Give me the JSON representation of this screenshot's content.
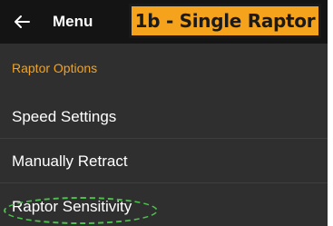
{
  "header": {
    "back_icon": "arrow-left-icon",
    "title": "Menu",
    "badge": "1b - Single Raptor",
    "badge_color": "#f5a31c"
  },
  "section": {
    "label": "Raptor Options"
  },
  "items": [
    {
      "label": "Speed Settings"
    },
    {
      "label": "Manually Retract"
    },
    {
      "label": "Raptor Sensitivity"
    }
  ],
  "colors": {
    "background": "#2f2f2f",
    "header_background": "#141414",
    "accent": "#f5a31c",
    "highlight": "#4bc24b"
  }
}
